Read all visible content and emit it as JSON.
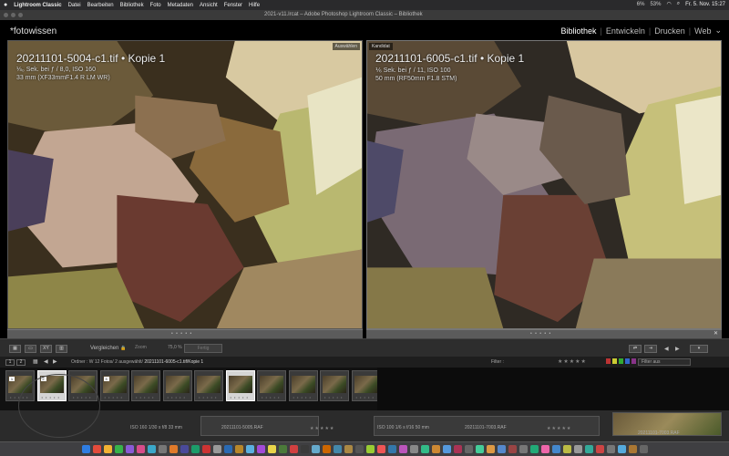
{
  "menubar": {
    "apple": "",
    "app": "Lightroom Classic",
    "items": [
      "Datei",
      "Bearbeiten",
      "Bibliothek",
      "Foto",
      "Metadaten",
      "Ansicht",
      "Fenster",
      "Hilfe"
    ],
    "window_title": "2021-...c11.lrcat – Adobe Photoshop Lightroom Classic – Bibliothek",
    "battery": "53%",
    "volume": "6%",
    "clock": "Fr. 5. Nov. 15:27"
  },
  "window": {
    "title": "2021-v11.lrcat – Adobe Photoshop Lightroom Classic – Bibliothek"
  },
  "identity_plate": "*fotowissen",
  "modules": {
    "items": [
      "Bibliothek",
      "Entwickeln",
      "Drucken",
      "Web"
    ],
    "active": "Bibliothek"
  },
  "compare": {
    "left": {
      "tag": "Auswählen",
      "filename": "20211101-5004-c1.tif  •  Kopie 1",
      "exif1": "⅓₀ Sek. bei ƒ / 8,0, ISO 160",
      "exif2": "33 mm (XF33mmF1.4 R LM WR)"
    },
    "right": {
      "tag": "Kandidat",
      "filename": "20211101-6005-c1.tif  •  Kopie 1",
      "exif1": "⅙ Sek. bei ƒ / 11, ISO 100",
      "exif2": "50 mm (RF50mm F1.8 STM)"
    },
    "rating_dots": "• • • • •",
    "close_glyph": "✕"
  },
  "toolbar": {
    "compare_label": "Vergleichen",
    "lock_glyph": "🔒",
    "zoom_label": "Zoom",
    "zoom_value": "75,0 %",
    "done_button": "Fertig",
    "btn1": "▦",
    "btn2": "▭",
    "btn3": "XY",
    "btn4": "▥"
  },
  "filmstrip_nav": {
    "num1": "1",
    "num2": "2",
    "back": "◀",
    "forward": "▶",
    "grid_glyph": "▦",
    "path_prefix": "Ordner : W   12 Fotos/ 2 ausgewählt/",
    "path_selected": "20211101-6005-c1.tif/Kopie 1",
    "filter_label": "Filter :",
    "filter_stars": "★★★★★",
    "filter_select": "Filter aus"
  },
  "thumbnails": [
    {
      "badge": "1",
      "selected": false
    },
    {
      "badge": "2",
      "selected": true
    },
    {
      "badge": "",
      "selected": false
    },
    {
      "badge": "3",
      "selected": false
    },
    {
      "badge": "",
      "selected": false
    },
    {
      "badge": "",
      "selected": false
    },
    {
      "badge": "",
      "selected": false
    },
    {
      "badge": "",
      "selected": true
    },
    {
      "badge": "",
      "selected": false
    },
    {
      "badge": "",
      "selected": false
    },
    {
      "badge": "",
      "selected": false
    },
    {
      "badge": "",
      "selected": false
    }
  ],
  "background_app": {
    "iso": "ISO 160   1/30 s   f/8   33 mm",
    "file1": "20211101-5005.RAF",
    "iso2": "ISO 100   1/6 s   f/16   50 mm",
    "file2": "20211101-7003.RAF",
    "file3": "20211101-7003.RAF",
    "stars": "★★★★★"
  }
}
